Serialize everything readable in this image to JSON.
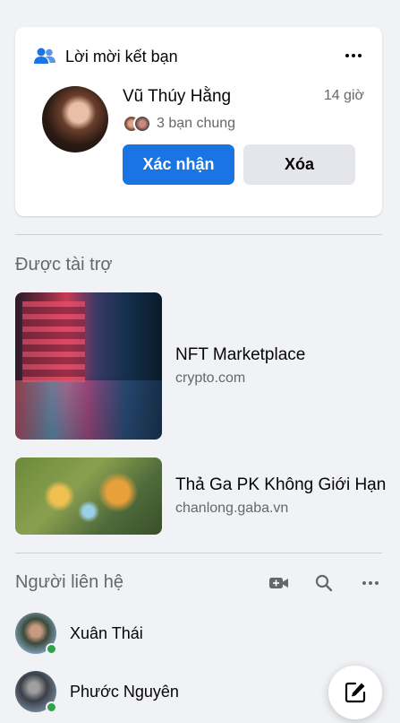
{
  "friend_request": {
    "header_title": "Lời mời kết bạn",
    "header_icon": "friends-icon",
    "name": "Vũ Thúy Hằng",
    "time": "14 giờ",
    "mutual_friends": "3 bạn chung",
    "confirm_label": "Xác nhận",
    "delete_label": "Xóa"
  },
  "sponsored": {
    "title": "Được tài trợ",
    "ads": [
      {
        "title": "NFT Marketplace",
        "domain": "crypto.com"
      },
      {
        "title": "Thả Ga PK Không Giới Hạn",
        "domain": "chanlong.gaba.vn"
      }
    ]
  },
  "contacts": {
    "title": "Người liên hệ",
    "items": [
      {
        "name": "Xuân Thái",
        "online": true
      },
      {
        "name": "Phước Nguyên",
        "online": true
      }
    ]
  },
  "colors": {
    "primary": "#1b74e4",
    "background": "#f0f2f5",
    "online": "#31a24c",
    "secondary_text": "#65676b"
  }
}
